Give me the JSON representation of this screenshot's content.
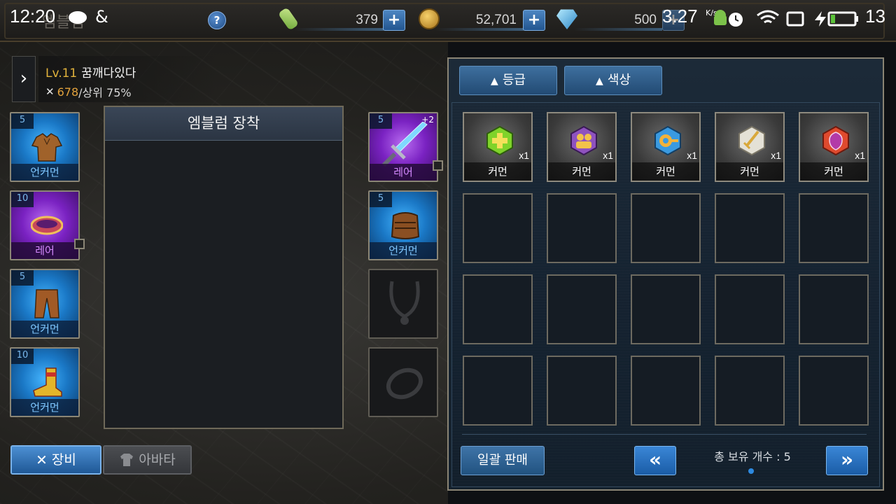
{
  "status_bar": {
    "time": "12:20",
    "title_ghost": "엠블럼",
    "speed": "3.27",
    "speed_unit": "K/s",
    "battery": "13"
  },
  "resources": {
    "stamina": "379",
    "gold": "52,701",
    "gems": "500",
    "plus_label": "+",
    "help_label": "?"
  },
  "character": {
    "level": "Lv.11",
    "name": "꿈깨다있다",
    "power": "678",
    "rank": "/상위 75%"
  },
  "equip_left": [
    {
      "level": "5",
      "grade": "언커먼",
      "rarity": "uncommon",
      "item": "armor"
    },
    {
      "level": "10",
      "grade": "레어",
      "rarity": "rare",
      "item": "belt"
    },
    {
      "level": "5",
      "grade": "언커먼",
      "rarity": "uncommon",
      "item": "pants"
    },
    {
      "level": "10",
      "grade": "언커먼",
      "rarity": "uncommon",
      "item": "boots"
    }
  ],
  "equip_right": [
    {
      "level": "5",
      "grade": "레어",
      "rarity": "rare",
      "enhance": "+2",
      "item": "sword"
    },
    {
      "level": "5",
      "grade": "언커먼",
      "rarity": "uncommon",
      "item": "gloves"
    },
    {
      "item": "necklace-empty"
    },
    {
      "item": "ring-empty"
    }
  ],
  "emblem_panel": {
    "title": "엠블럼 장착"
  },
  "tabs": {
    "equip": "장비",
    "avatar": "아바타"
  },
  "inventory": {
    "sort_grade": "등급",
    "sort_color": "색상",
    "sort_arrow": "▲",
    "items": [
      {
        "grade": "커먼",
        "count": "x1",
        "color": "#5fc21e",
        "icon": "heal-emblem-icon"
      },
      {
        "grade": "커먼",
        "count": "x1",
        "color": "#8b4fb8",
        "icon": "party-emblem-icon"
      },
      {
        "grade": "커먼",
        "count": "x1",
        "color": "#2f8fd6",
        "icon": "target-emblem-icon"
      },
      {
        "grade": "커먼",
        "count": "x1",
        "color": "#d9d6cc",
        "icon": "sword-emblem-icon"
      },
      {
        "grade": "커먼",
        "count": "x1",
        "color": "#d8402b",
        "icon": "shield-emblem-icon"
      }
    ],
    "bulk_sell": "일괄 판매",
    "total_label": "총 보유 개수 : 5",
    "prev_label": "«",
    "next_label": "»"
  }
}
